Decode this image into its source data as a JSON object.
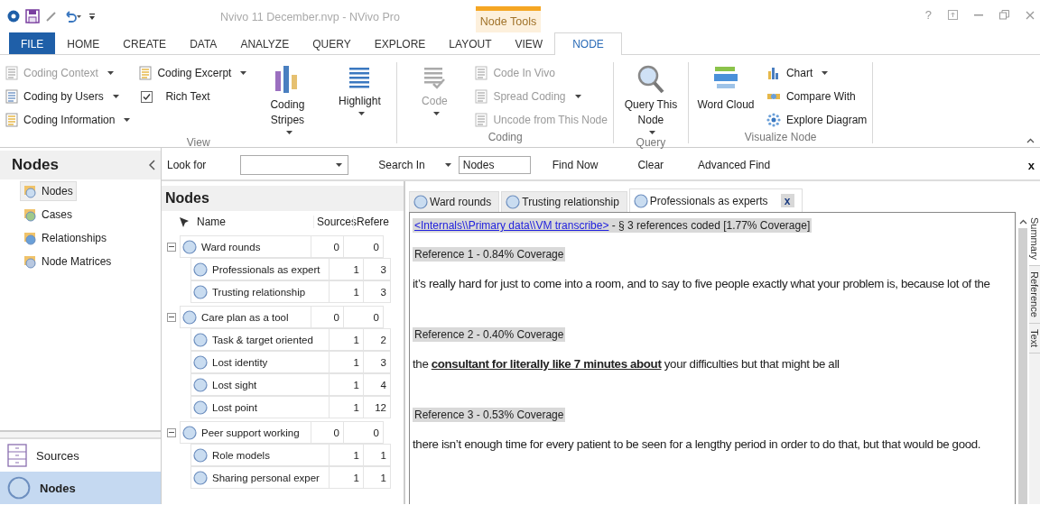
{
  "window": {
    "title": "Nvivo 11 December.nvp - NVivo Pro",
    "contextual_tab": "Node Tools",
    "help": "?"
  },
  "ribbon_tabs": [
    {
      "label": "FILE",
      "kind": "file",
      "selected": false
    },
    {
      "label": "HOME",
      "kind": "tab",
      "selected": false
    },
    {
      "label": "CREATE",
      "kind": "tab",
      "selected": false
    },
    {
      "label": "DATA",
      "kind": "tab",
      "selected": false
    },
    {
      "label": "ANALYZE",
      "kind": "tab",
      "selected": false
    },
    {
      "label": "QUERY",
      "kind": "tab",
      "selected": false
    },
    {
      "label": "EXPLORE",
      "kind": "tab",
      "selected": false
    },
    {
      "label": "LAYOUT",
      "kind": "tab",
      "selected": false
    },
    {
      "label": "VIEW",
      "kind": "tab",
      "selected": false
    },
    {
      "label": "NODE",
      "kind": "tab",
      "selected": true
    }
  ],
  "ribbon_groups": [
    {
      "label": "View",
      "items": [
        {
          "kind": "stack",
          "items": [
            {
              "label": "Coding Context",
              "dropdown": true,
              "disabled": true
            },
            {
              "label": "Coding by Users",
              "dropdown": true,
              "disabled": false
            },
            {
              "label": "Coding Information",
              "dropdown": true,
              "disabled": false
            }
          ]
        },
        {
          "kind": "stack",
          "items": [
            {
              "label": "Coding Excerpt",
              "dropdown": true,
              "disabled": false
            },
            {
              "label": "Rich Text",
              "kind": "checkbox",
              "checked": true,
              "disabled": false
            }
          ]
        },
        {
          "kind": "large",
          "label": "Coding Stripes",
          "dropdown": true,
          "disabled": false
        },
        {
          "kind": "large",
          "label": "Highlight",
          "dropdown": true,
          "disabled": false
        }
      ]
    },
    {
      "label": "Coding",
      "items": [
        {
          "kind": "large",
          "label": "Code",
          "dropdown": true,
          "disabled": true
        },
        {
          "kind": "stack",
          "items": [
            {
              "label": "Code In Vivo",
              "dropdown": false,
              "disabled": true
            },
            {
              "label": "Spread Coding",
              "dropdown": true,
              "disabled": true
            },
            {
              "label": "Uncode from This Node",
              "dropdown": false,
              "disabled": true
            }
          ]
        }
      ]
    },
    {
      "label": "Query",
      "items": [
        {
          "kind": "large",
          "label": "Query This Node",
          "dropdown": true,
          "disabled": false
        }
      ]
    },
    {
      "label": "Visualize Node",
      "items": [
        {
          "kind": "large",
          "label": "Word Cloud",
          "dropdown": false,
          "disabled": false
        },
        {
          "kind": "stack",
          "items": [
            {
              "label": "Chart",
              "dropdown": true,
              "disabled": false
            },
            {
              "label": "Compare With",
              "dropdown": false,
              "disabled": false
            },
            {
              "label": "Explore Diagram",
              "dropdown": false,
              "disabled": false
            }
          ]
        }
      ]
    }
  ],
  "find_bar": {
    "look_for_label": "Look for",
    "search_in_label": "Search In",
    "search_in_value": "Nodes",
    "buttons": [
      "Find Now",
      "Clear",
      "Advanced Find"
    ],
    "close": "x"
  },
  "navigation": {
    "title": "Nodes",
    "items": [
      {
        "label": "Nodes",
        "selected": true
      },
      {
        "label": "Cases",
        "selected": false
      },
      {
        "label": "Relationships",
        "selected": false
      },
      {
        "label": "Node Matrices",
        "selected": false
      }
    ],
    "sections": [
      {
        "label": "Sources",
        "selected": false
      },
      {
        "label": "Nodes",
        "selected": true
      }
    ]
  },
  "node_list": {
    "title": "Nodes",
    "columns": [
      "Name",
      "Sources",
      "Refere"
    ],
    "rows": [
      {
        "name": "Ward rounds",
        "sources": "0",
        "references": "0",
        "expanded": true,
        "children": [
          {
            "name": "Professionals as expert",
            "sources": "1",
            "references": "3"
          },
          {
            "name": "Trusting relationship",
            "sources": "1",
            "references": "3"
          }
        ]
      },
      {
        "name": "Care plan as a tool",
        "sources": "0",
        "references": "0",
        "expanded": true,
        "children": [
          {
            "name": "Task & target oriented",
            "sources": "1",
            "references": "2"
          },
          {
            "name": "Lost identity",
            "sources": "1",
            "references": "3"
          },
          {
            "name": "Lost sight",
            "sources": "1",
            "references": "4"
          },
          {
            "name": "Lost point",
            "sources": "1",
            "references": "12"
          }
        ]
      },
      {
        "name": "Peer support working",
        "sources": "0",
        "references": "0",
        "expanded": true,
        "children": [
          {
            "name": "Role models",
            "sources": "1",
            "references": "1"
          },
          {
            "name": "Sharing personal exper",
            "sources": "1",
            "references": "1"
          }
        ]
      }
    ]
  },
  "document_tabs": [
    {
      "label": "Ward rounds",
      "selected": false
    },
    {
      "label": "Trusting relationship",
      "selected": false
    },
    {
      "label": "Professionals as experts",
      "selected": true,
      "close": "x"
    }
  ],
  "document": {
    "source_link": "<Internals\\\\Primary data\\\\VM transcribe>",
    "source_summary": " - § 3 references coded  [1.77% Coverage]",
    "references": [
      {
        "heading": "Reference 1 - 0.84% Coverage",
        "text": " it’s really hard for just to come into a room, and to say to five people exactly what your problem is, because lot of the"
      },
      {
        "heading": "Reference 2 - 0.40% Coverage",
        "text": "the **consultant for literally like 7 minutes about** your difficulties but that might be all"
      },
      {
        "heading": "Reference 3 - 0.53% Coverage",
        "text": "there isn’t enough time for every patient to be seen for a lengthy period in order to do that, but that would be good."
      }
    ]
  },
  "side_tabs": [
    {
      "label": "Summary",
      "selected": true
    },
    {
      "label": "Reference",
      "selected": false
    },
    {
      "label": "Text",
      "selected": false
    }
  ]
}
